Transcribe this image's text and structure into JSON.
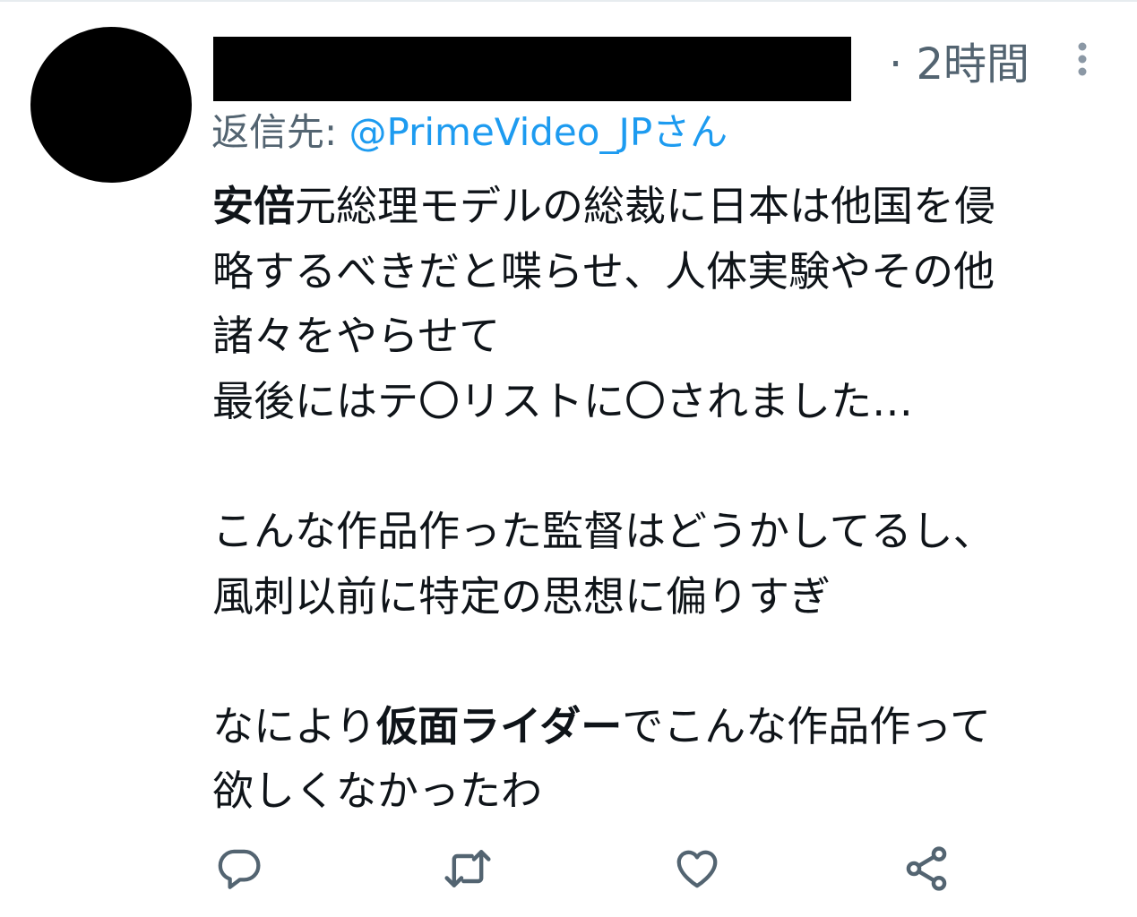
{
  "tweet": {
    "time": "· 2時間",
    "reply_prefix": "返信先: ",
    "reply_handle": "@PrimeVideo_JPさん",
    "lines": [
      {
        "bold": "安倍",
        "rest": "元総理モデルの総裁に日本は他国を侵"
      },
      {
        "text": "略するべきだと喋らせ、人体実験やその他"
      },
      {
        "text": "諸々をやらせて"
      },
      {
        "text": "最後にはテ〇リストに〇されました…"
      },
      {
        "text": ""
      },
      {
        "text": "こんな作品作った監督はどうかしてるし、"
      },
      {
        "text": "風刺以前に特定の思想に偏りすぎ"
      },
      {
        "text": ""
      },
      {
        "pre": "なにより",
        "bold": "仮面ライダー",
        "post": "でこんな作品作って"
      },
      {
        "text": "欲しくなかったわ"
      }
    ]
  },
  "icons": {
    "more": "more-vertical-icon",
    "reply": "reply-icon",
    "retweet": "retweet-icon",
    "like": "heart-icon",
    "share": "share-icon"
  },
  "colors": {
    "secondary_text": "#536471",
    "link": "#1d9bf0",
    "icon": "#536471",
    "text": "#0f1419"
  }
}
